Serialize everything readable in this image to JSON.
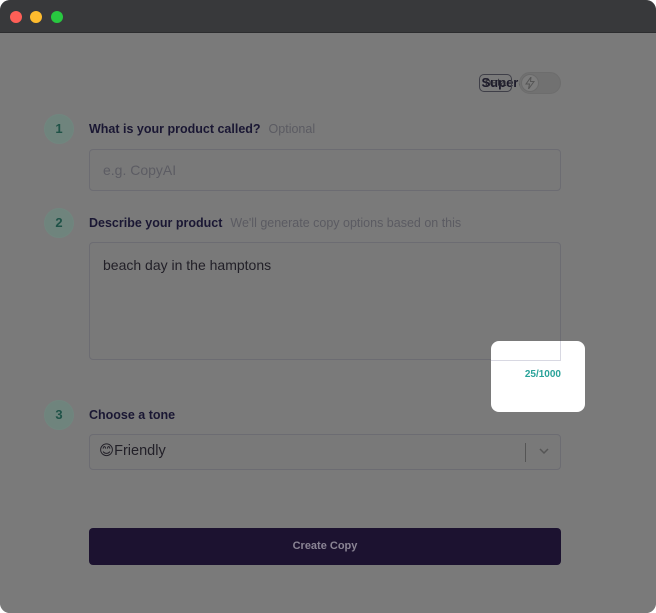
{
  "window": {
    "controls": [
      "close",
      "minimize",
      "maximize"
    ]
  },
  "supercharge": {
    "label": "Supercharge",
    "badge": "beta",
    "toggle_icon": "lightning-icon",
    "enabled": false
  },
  "steps": [
    {
      "number": "1",
      "label": "What is your product called?",
      "hint": "Optional",
      "input_placeholder": "e.g. CopyAI",
      "input_value": ""
    },
    {
      "number": "2",
      "label": "Describe your product",
      "hint": "We'll generate copy options based on this",
      "input_value": "beach day in the hamptons",
      "char_count": "25/1000"
    },
    {
      "number": "3",
      "label": "Choose a tone",
      "selected_emoji": "😊",
      "selected_value": "Friendly"
    }
  ],
  "actions": {
    "create_label": "Create Copy"
  },
  "colors": {
    "accent_teal": "#2aa39a",
    "button_dark": "#1c1230",
    "overlay": "#7a7a7a"
  }
}
